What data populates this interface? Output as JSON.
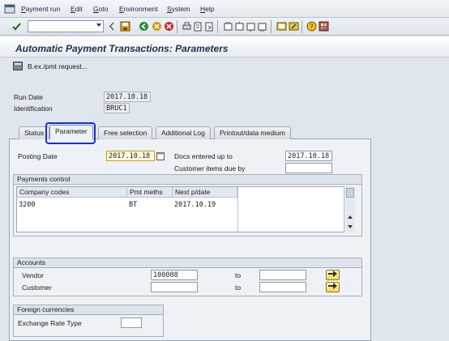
{
  "menu": {
    "items": [
      "Payment run",
      "Edit",
      "Goto",
      "Environment",
      "System",
      "Help"
    ]
  },
  "toolbar": {
    "command_value": ""
  },
  "page": {
    "title": "Automatic Payment Transactions: Parameters",
    "app_button_label": "B.ex./pmt request..."
  },
  "header": {
    "run_date_label": "Run Date",
    "run_date": "2017.10.18",
    "identification_label": "Identification",
    "identification": "BRUC1"
  },
  "tabs": [
    "Status",
    "Parameter",
    "Free selection",
    "Additional Log",
    "Printout/data medium"
  ],
  "parameter": {
    "posting_date_label": "Posting Date",
    "posting_date": "2017.10.18",
    "docs_entered_label": "Docs entered up to",
    "docs_entered": "2017.10.18",
    "customer_items_label": "Customer items due by",
    "customer_items": ""
  },
  "payments_control": {
    "title": "Payments control",
    "columns": [
      "Company codes",
      "Pmt meths",
      "Next p/date"
    ],
    "rows": [
      [
        "3200",
        "BT",
        "2017.10.19"
      ]
    ]
  },
  "accounts": {
    "title": "Accounts",
    "vendor_label": "Vendor",
    "vendor_from": "100008",
    "vendor_to": "",
    "customer_label": "Customer",
    "customer_from": "",
    "customer_to": "",
    "to_label": "to"
  },
  "foreign": {
    "title": "Foreign currencies",
    "exchange_rate_label": "Exchange Rate Type",
    "exchange_rate": ""
  },
  "colors": {
    "highlight": "#1530d6",
    "title": "#1c2f4e"
  }
}
